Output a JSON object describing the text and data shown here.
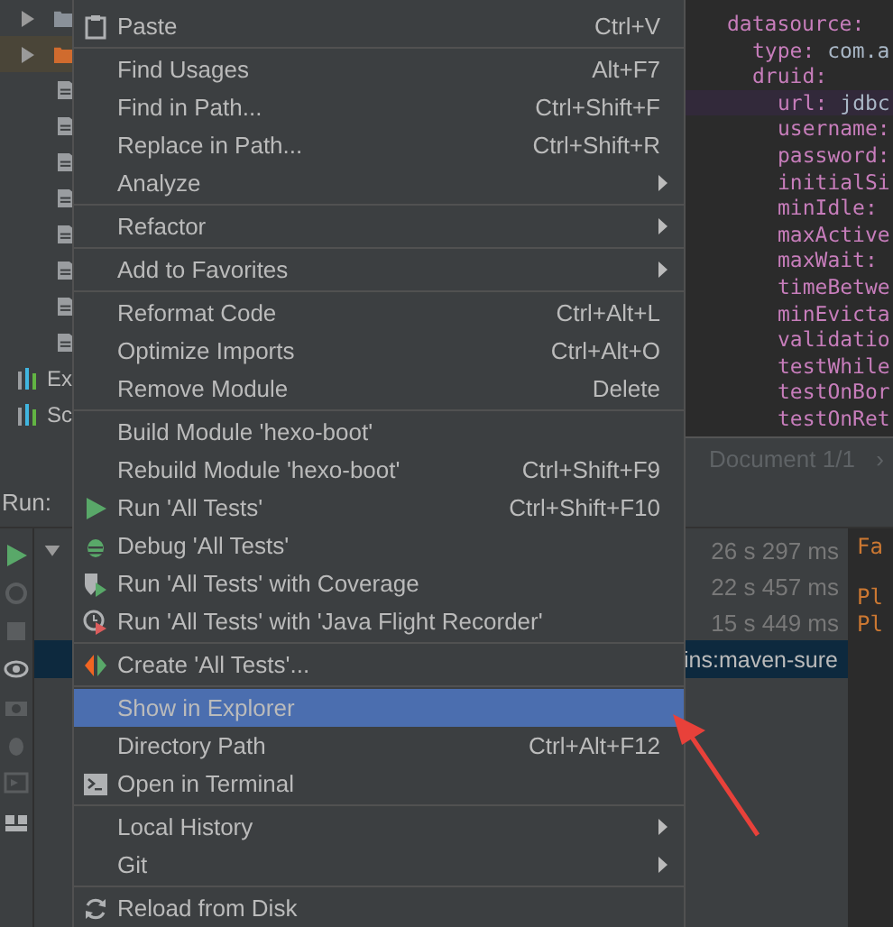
{
  "project_tree": {
    "items": [
      {
        "kind": "folder",
        "expanded": false,
        "selected": false
      },
      {
        "kind": "folder",
        "expanded": false,
        "selected": true
      },
      {
        "kind": "file",
        "selected": false
      },
      {
        "kind": "file",
        "selected": false
      },
      {
        "kind": "file",
        "selected": false
      },
      {
        "kind": "file",
        "selected": false
      },
      {
        "kind": "file",
        "selected": false
      },
      {
        "kind": "file",
        "selected": false
      },
      {
        "kind": "file",
        "selected": false
      },
      {
        "kind": "file",
        "selected": false
      },
      {
        "kind": "tool",
        "label": "Ex",
        "selected": false
      },
      {
        "kind": "tool",
        "label": "Sc",
        "selected": false
      }
    ]
  },
  "editor": {
    "lines": [
      {
        "key": "datasource:",
        "current": false,
        "children": [
          {
            "key": "type:",
            "value": "com.a",
            "current": false
          },
          {
            "key": "druid:",
            "current": false,
            "children": [
              {
                "key": "url:",
                "value": "jdbc",
                "current": true
              },
              {
                "key": "username:",
                "current": false
              },
              {
                "key": "password:",
                "current": false
              },
              {
                "key": "initialSi",
                "current": false
              },
              {
                "key": "minIdle:",
                "current": false
              },
              {
                "key": "maxActive",
                "current": false
              },
              {
                "key": "maxWait:",
                "current": false
              },
              {
                "key": "timeBetwe",
                "current": false
              },
              {
                "key": "minEvicta",
                "current": false
              },
              {
                "key": "validatio",
                "current": false
              },
              {
                "key": "testWhile",
                "current": false
              },
              {
                "key": "testOnBor",
                "current": false
              },
              {
                "key": "testOnRet",
                "current": false
              }
            ]
          }
        ]
      }
    ],
    "status": "Document 1/1",
    "status_arrow": "›"
  },
  "run_panel": {
    "title": "Run:",
    "rows": [
      {
        "time": "26 s 297 ms",
        "expanded": true,
        "selected": false
      },
      {
        "time": "22 s 457 ms",
        "selected": false
      },
      {
        "time": "15 s 449 ms",
        "selected": false
      },
      {
        "label": "ins:maven-sure",
        "selected": true
      }
    ],
    "console": [
      {
        "text": "Fa"
      },
      {
        "text": "Pl"
      },
      {
        "text": "Pl"
      }
    ]
  },
  "context_menu": {
    "groups": [
      [
        {
          "label": "Paste",
          "shortcut": "Ctrl+V",
          "submenu": false,
          "selected": false
        }
      ],
      [
        {
          "label": "Find Usages",
          "shortcut": "Alt+F7",
          "submenu": false,
          "selected": false
        },
        {
          "label": "Find in Path...",
          "shortcut": "Ctrl+Shift+F",
          "submenu": false,
          "selected": false
        },
        {
          "label": "Replace in Path...",
          "shortcut": "Ctrl+Shift+R",
          "submenu": false,
          "selected": false
        },
        {
          "label": "Analyze",
          "submenu": true,
          "selected": false
        }
      ],
      [
        {
          "label": "Refactor",
          "submenu": true,
          "selected": false
        }
      ],
      [
        {
          "label": "Add to Favorites",
          "submenu": true,
          "selected": false
        }
      ],
      [
        {
          "label": "Reformat Code",
          "shortcut": "Ctrl+Alt+L",
          "submenu": false,
          "selected": false
        },
        {
          "label": "Optimize Imports",
          "shortcut": "Ctrl+Alt+O",
          "submenu": false,
          "selected": false
        },
        {
          "label": "Remove Module",
          "shortcut": "Delete",
          "submenu": false,
          "selected": false
        }
      ],
      [
        {
          "label": "Build Module 'hexo-boot'",
          "submenu": false,
          "selected": false
        },
        {
          "label": "Rebuild Module 'hexo-boot'",
          "shortcut": "Ctrl+Shift+F9",
          "submenu": false,
          "selected": false
        },
        {
          "label": "Run 'All Tests'",
          "shortcut": "Ctrl+Shift+F10",
          "submenu": false,
          "selected": false
        },
        {
          "label": "Debug 'All Tests'",
          "submenu": false,
          "selected": false
        },
        {
          "label": "Run 'All Tests' with Coverage",
          "submenu": false,
          "selected": false
        },
        {
          "label": "Run 'All Tests' with 'Java Flight Recorder'",
          "submenu": false,
          "selected": false
        }
      ],
      [
        {
          "label": "Create 'All Tests'...",
          "submenu": false,
          "selected": false
        }
      ],
      [
        {
          "label": "Show in Explorer",
          "submenu": false,
          "selected": true
        },
        {
          "label": "Directory Path",
          "shortcut": "Ctrl+Alt+F12",
          "submenu": false,
          "selected": false
        },
        {
          "label": "Open in Terminal",
          "submenu": false,
          "selected": false
        }
      ],
      [
        {
          "label": "Local History",
          "submenu": true,
          "selected": false
        },
        {
          "label": "Git",
          "submenu": true,
          "selected": false
        }
      ],
      [
        {
          "label": "Reload from Disk",
          "submenu": false,
          "selected": false
        }
      ]
    ]
  }
}
